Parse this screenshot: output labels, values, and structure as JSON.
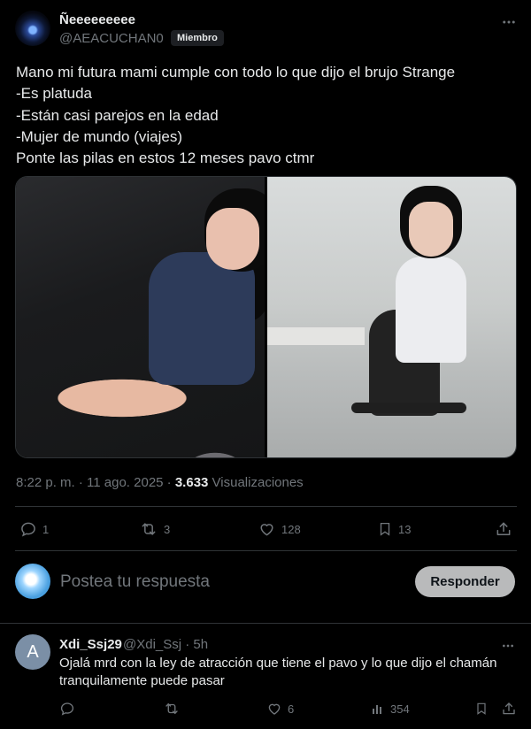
{
  "tweet": {
    "author": {
      "display_name": "Ñeeeeeeeee",
      "handle": "@AEACUCHAN0",
      "badge": "Miembro"
    },
    "text_lines": [
      "Mano mi futura mami cumple con todo lo que dijo el brujo Strange",
      "-Es platuda",
      "-Están casi parejos en la edad",
      "-Mujer de mundo (viajes)",
      "Ponte las pilas en estos 12 meses pavo ctmr"
    ],
    "media": [
      {
        "icon": "photo-woman-on-couch"
      },
      {
        "icon": "photo-woman-office-chair"
      }
    ],
    "timestamp": "8:22 p. m. · 11 ago. 2025 · ",
    "views_count": "3.633",
    "views_label": " Visualizaciones",
    "actions": {
      "replies": "1",
      "reposts": "3",
      "likes": "128",
      "bookmarks": "13"
    }
  },
  "compose": {
    "placeholder": "Postea tu respuesta",
    "button_label": "Responder"
  },
  "reply": {
    "avatar_letter": "A",
    "display_name": "Xdi_Ssj29",
    "handle": "@Xdi_Ssj · 5h",
    "text": "Ojalá mrd con la ley de atracción que tiene el pavo y lo que dijo el chamán tranquilamente puede pasar",
    "actions": {
      "replies": "",
      "reposts": "",
      "likes": "6",
      "views": "354"
    }
  },
  "colors": {
    "background": "#000000",
    "text": "#e7e9ea",
    "muted": "#71767b",
    "divider": "#2f3336",
    "button_bg": "#b9babb"
  }
}
